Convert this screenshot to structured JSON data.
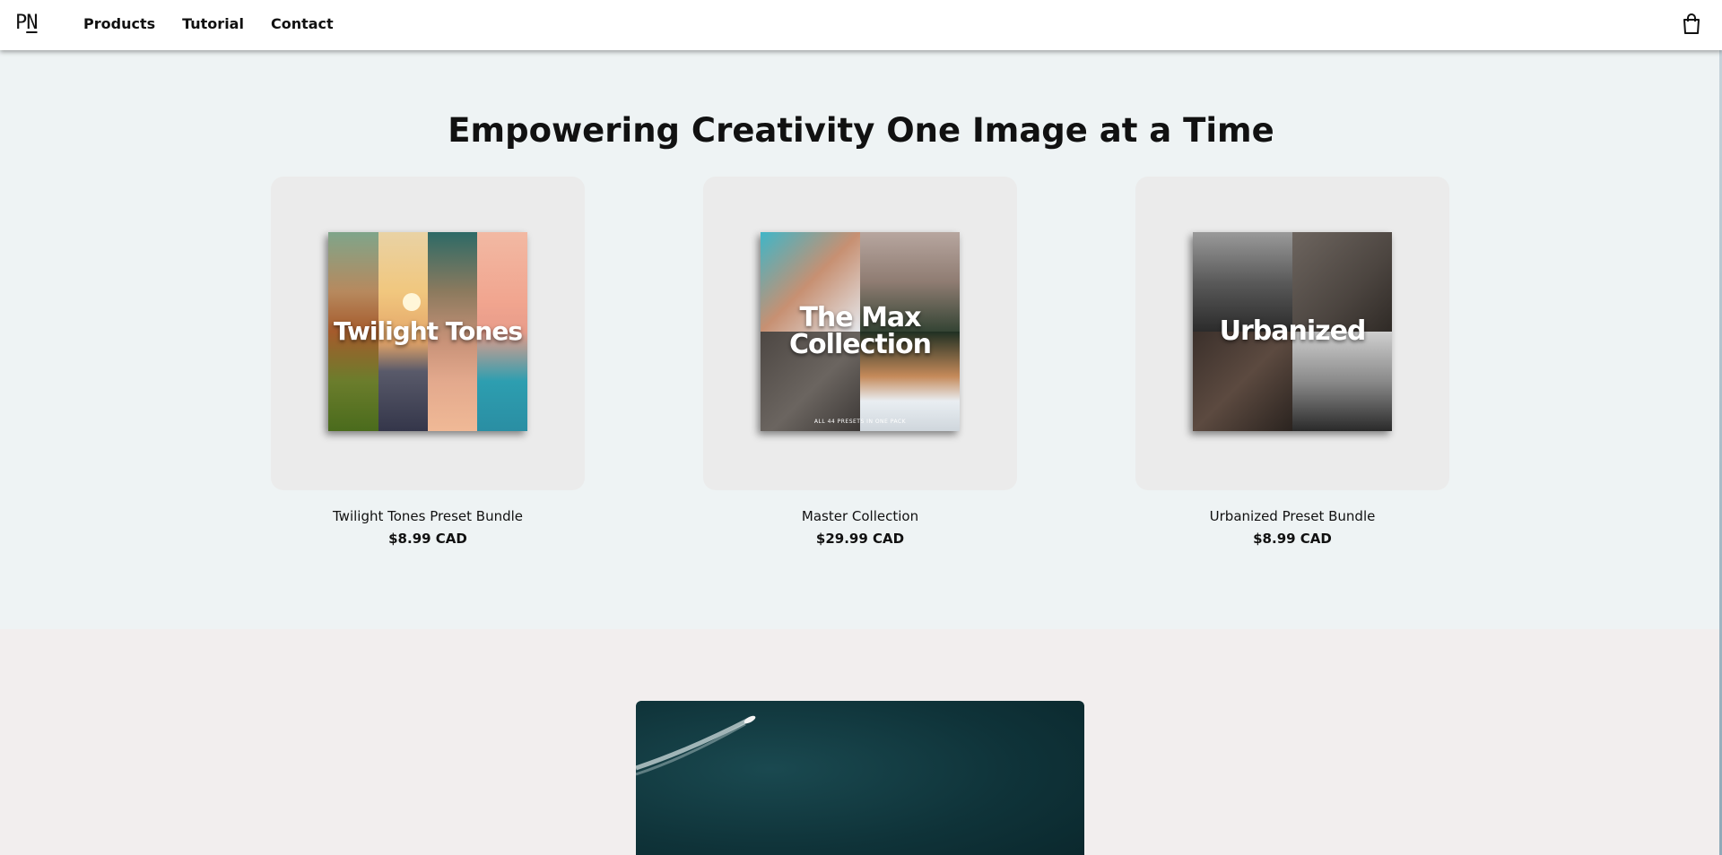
{
  "header": {
    "logo": {
      "p": "P",
      "n": "N"
    },
    "nav": [
      "Products",
      "Tutorial",
      "Contact"
    ],
    "cart_icon": "shopping-bag-icon"
  },
  "featured": {
    "headline": "Empowering Creativity One Image at a Time",
    "products": [
      {
        "name": "Twilight Tones Preset Bundle",
        "price": "$8.99 CAD",
        "cover_title": "Twilight Tones"
      },
      {
        "name": "Master Collection",
        "price": "$29.99 CAD",
        "cover_title_line1": "The Max",
        "cover_title_line2": "Collection",
        "cover_subtitle": "ALL 44 PRESETS IN ONE PACK"
      },
      {
        "name": "Urbanized Preset Bundle",
        "price": "$8.99 CAD",
        "cover_title": "Urbanized"
      }
    ]
  },
  "colors": {
    "header_bg": "#ffffff",
    "featured_bg": "#eef3f4",
    "card_bg": "#ebebeb",
    "hero_section_bg": "#f2eeee",
    "hero_water": "#0f3339"
  }
}
